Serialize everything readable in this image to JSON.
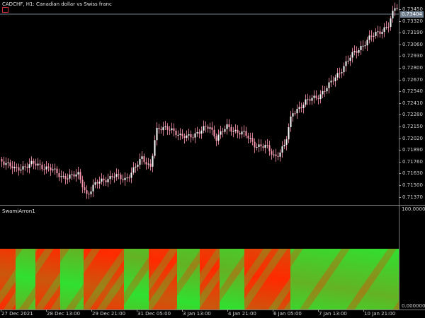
{
  "chart": {
    "title": "CADCHF, H1:  Canadian dollar vs Swiss franc",
    "current_price": "0.73404",
    "price_labels": [
      "0.73450",
      "0.73320",
      "0.73190",
      "0.73060",
      "0.72930",
      "0.72800",
      "0.72670",
      "0.72540",
      "0.72410",
      "0.72280",
      "0.72150",
      "0.72020",
      "0.71890",
      "0.71760",
      "0.71630",
      "0.71500",
      "0.71370"
    ],
    "time_labels": [
      "27 Dec 2021",
      "28 Dec 13:00",
      "29 Dec 21:00",
      "31 Dec 05:00",
      "3 Jan 13:00",
      "4 Jan 21:00",
      "6 Jan 05:00",
      "7 Jan 13:00",
      "10 Jan 21:00"
    ]
  },
  "indicator": {
    "title": "SwamiArron1",
    "max_label": "100.000000",
    "min_label": "0.000000"
  },
  "colors": {
    "candle": "#ff9ab0",
    "background": "#000000",
    "red": "#ff2a00",
    "green": "#30e030"
  },
  "icons": {
    "trade": "trade-levels-icon"
  }
}
